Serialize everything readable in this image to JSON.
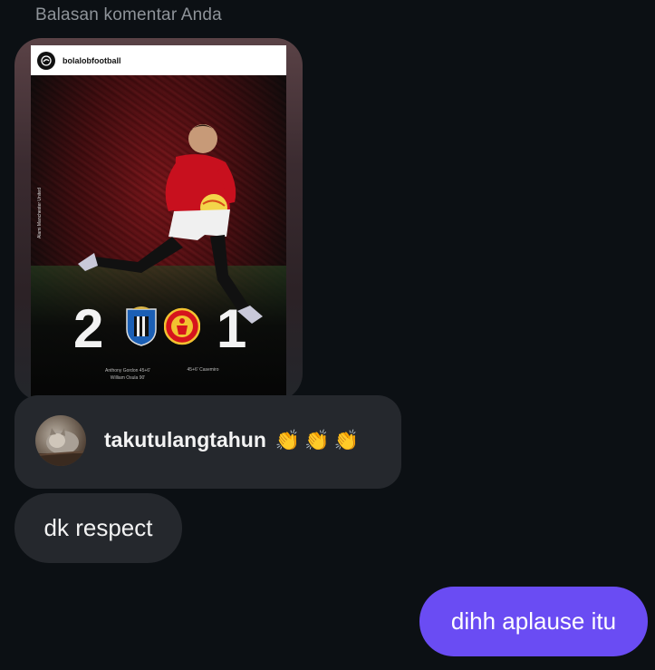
{
  "reply_caption": "Balasan komentar Anda",
  "shared_post": {
    "username": "bolalobfootball",
    "photo_credit": "Alami Manchester United",
    "score_home": "2",
    "score_away": "1",
    "scorers_home": [
      "Anthony Gordon 45+6'",
      "William Osula 90'"
    ],
    "scorers_away": [
      "45+6' Casemiro"
    ]
  },
  "comment": {
    "username": "takutulangtahun",
    "emoji": "👏👏👏"
  },
  "messages": {
    "incoming": "dk respect",
    "outgoing": "dihh aplause itu"
  },
  "colors": {
    "background": "#0c1014",
    "bubble_incoming": "#25282d",
    "bubble_outgoing": "#6a4cf3",
    "caption_text": "#8e9399"
  }
}
